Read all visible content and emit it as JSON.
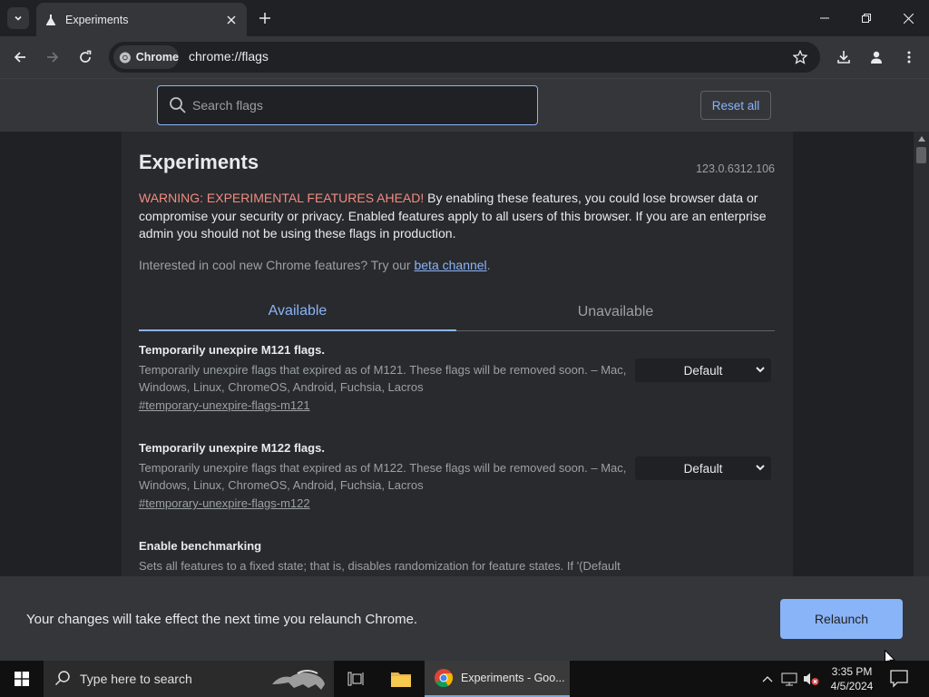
{
  "browser": {
    "tab_title": "Experiments",
    "chip_label": "Chrome",
    "url": "chrome://flags"
  },
  "flags_header": {
    "search_placeholder": "Search flags",
    "reset_label": "Reset all"
  },
  "page": {
    "title": "Experiments",
    "version": "123.0.6312.106",
    "warning_prefix": "WARNING: EXPERIMENTAL FEATURES AHEAD!",
    "warning_body": " By enabling these features, you could lose browser data or compromise your security or privacy. Enabled features apply to all users of this browser. If you are an enterprise admin you should not be using these flags in production.",
    "interest_text": "Interested in cool new Chrome features? Try our ",
    "beta_link": "beta channel",
    "interest_end": ".",
    "tabs": [
      "Available",
      "Unavailable"
    ],
    "flags": [
      {
        "name": "Temporarily unexpire M121 flags.",
        "description": "Temporarily unexpire flags that expired as of M121. These flags will be removed soon. – Mac, Windows, Linux, ChromeOS, Android, Fuchsia, Lacros",
        "link": "#temporary-unexpire-flags-m121",
        "value": "Default"
      },
      {
        "name": "Temporarily unexpire M122 flags.",
        "description": "Temporarily unexpire flags that expired as of M122. These flags will be removed soon. – Mac, Windows, Linux, ChromeOS, Android, Fuchsia, Lacros",
        "link": "#temporary-unexpire-flags-m122",
        "value": "Default"
      },
      {
        "name": "Enable benchmarking",
        "description": "Sets all features to a fixed state; that is, disables randomization for feature states. If '(Default"
      }
    ]
  },
  "relaunch": {
    "message": "Your changes will take effect the next time you relaunch Chrome.",
    "button": "Relaunch"
  },
  "taskbar": {
    "search_placeholder": "Type here to search",
    "chrome_task_label": "Experiments - Goo...",
    "time": "3:35 PM",
    "date": "4/5/2024"
  },
  "colors": {
    "accent": "#8ab4f8",
    "warning": "#f28b82",
    "background": "#202124",
    "surface": "#35363a"
  }
}
